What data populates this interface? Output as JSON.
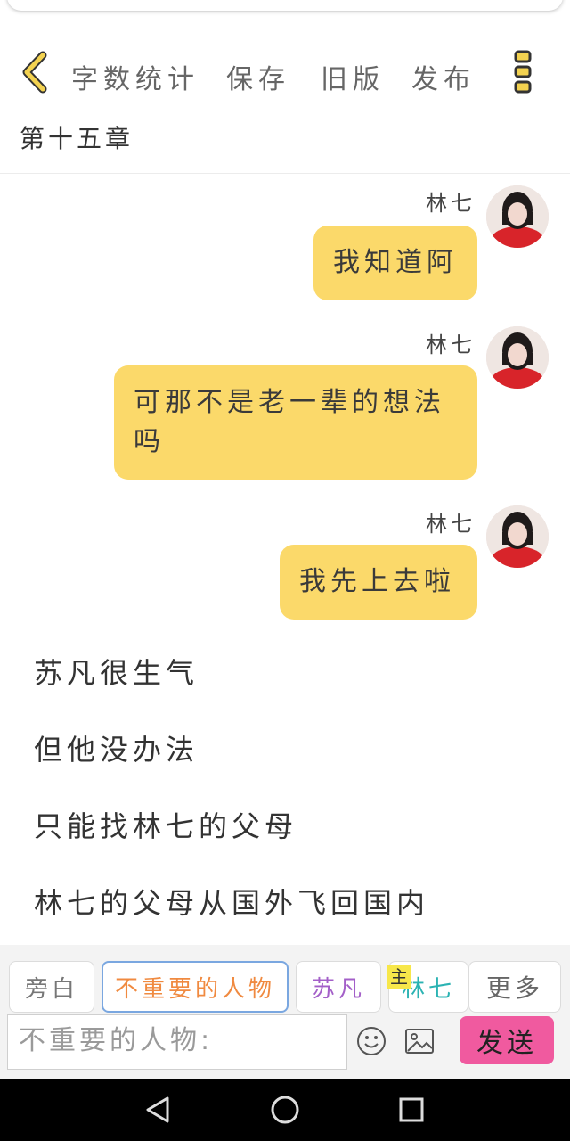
{
  "header": {
    "word_count_label": "字数统计",
    "save_label": "保存",
    "old_version_label": "旧版",
    "publish_label": "发布"
  },
  "chapter": {
    "title": "第十五章"
  },
  "messages": [
    {
      "sender": "林七",
      "text": "我知道阿"
    },
    {
      "sender": "林七",
      "text": "可那不是老一辈的想法吗"
    },
    {
      "sender": "林七",
      "text": "我先上去啦"
    }
  ],
  "narration": [
    "苏凡很生气",
    "但他没办法",
    "只能找林七的父母",
    "林七的父母从国外飞回国内"
  ],
  "roles": {
    "narrator": "旁白",
    "minor": "不重要的人物",
    "sufan": "苏凡",
    "linqi": "林七",
    "main_badge": "主",
    "more": "更多"
  },
  "input": {
    "prefix": "不重要的人物:"
  },
  "send_label": "发送",
  "colors": {
    "bubble": "#fbd96a",
    "send_button": "#f05a9f",
    "back_icon": "#f3d250",
    "more_icon": "#f3d250",
    "minor_role": "#f08a40",
    "sufan_role": "#a35fc8",
    "linqi_role": "#2bb3b3"
  }
}
